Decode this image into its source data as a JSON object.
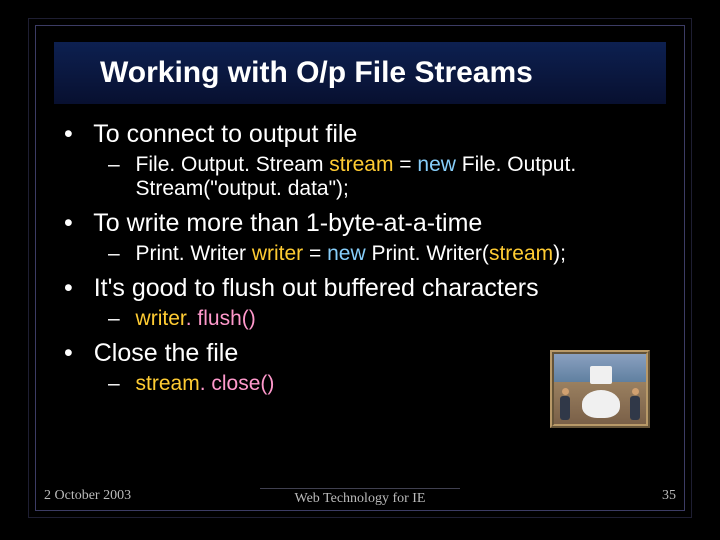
{
  "title": "Working with O/p File Streams",
  "bullets": {
    "b1": {
      "text": "To connect to output file"
    },
    "b1s1": {
      "plain1": "File. Output. Stream ",
      "var": "stream",
      "plain2": " = ",
      "kw": "new",
      "plain3": " File. Output. Stream(\"output. data\");"
    },
    "b2": {
      "text": "To write more than 1-byte-at-a-time"
    },
    "b2s1": {
      "plain1": "Print. Writer ",
      "var": "writer",
      "plain2": " = ",
      "kw": "new",
      "plain3": " Print. Writer(",
      "arg": "stream",
      "plain4": ");"
    },
    "b3": {
      "text": "It's good to flush out buffered characters"
    },
    "b3s1": {
      "var": "writer",
      "method": ". flush()"
    },
    "b4": {
      "text": "Close the file"
    },
    "b4s1": {
      "var": "stream",
      "method": ". close()"
    }
  },
  "footer": {
    "date": "2 October 2003",
    "center": "Web Technology for IE",
    "page": "35"
  }
}
